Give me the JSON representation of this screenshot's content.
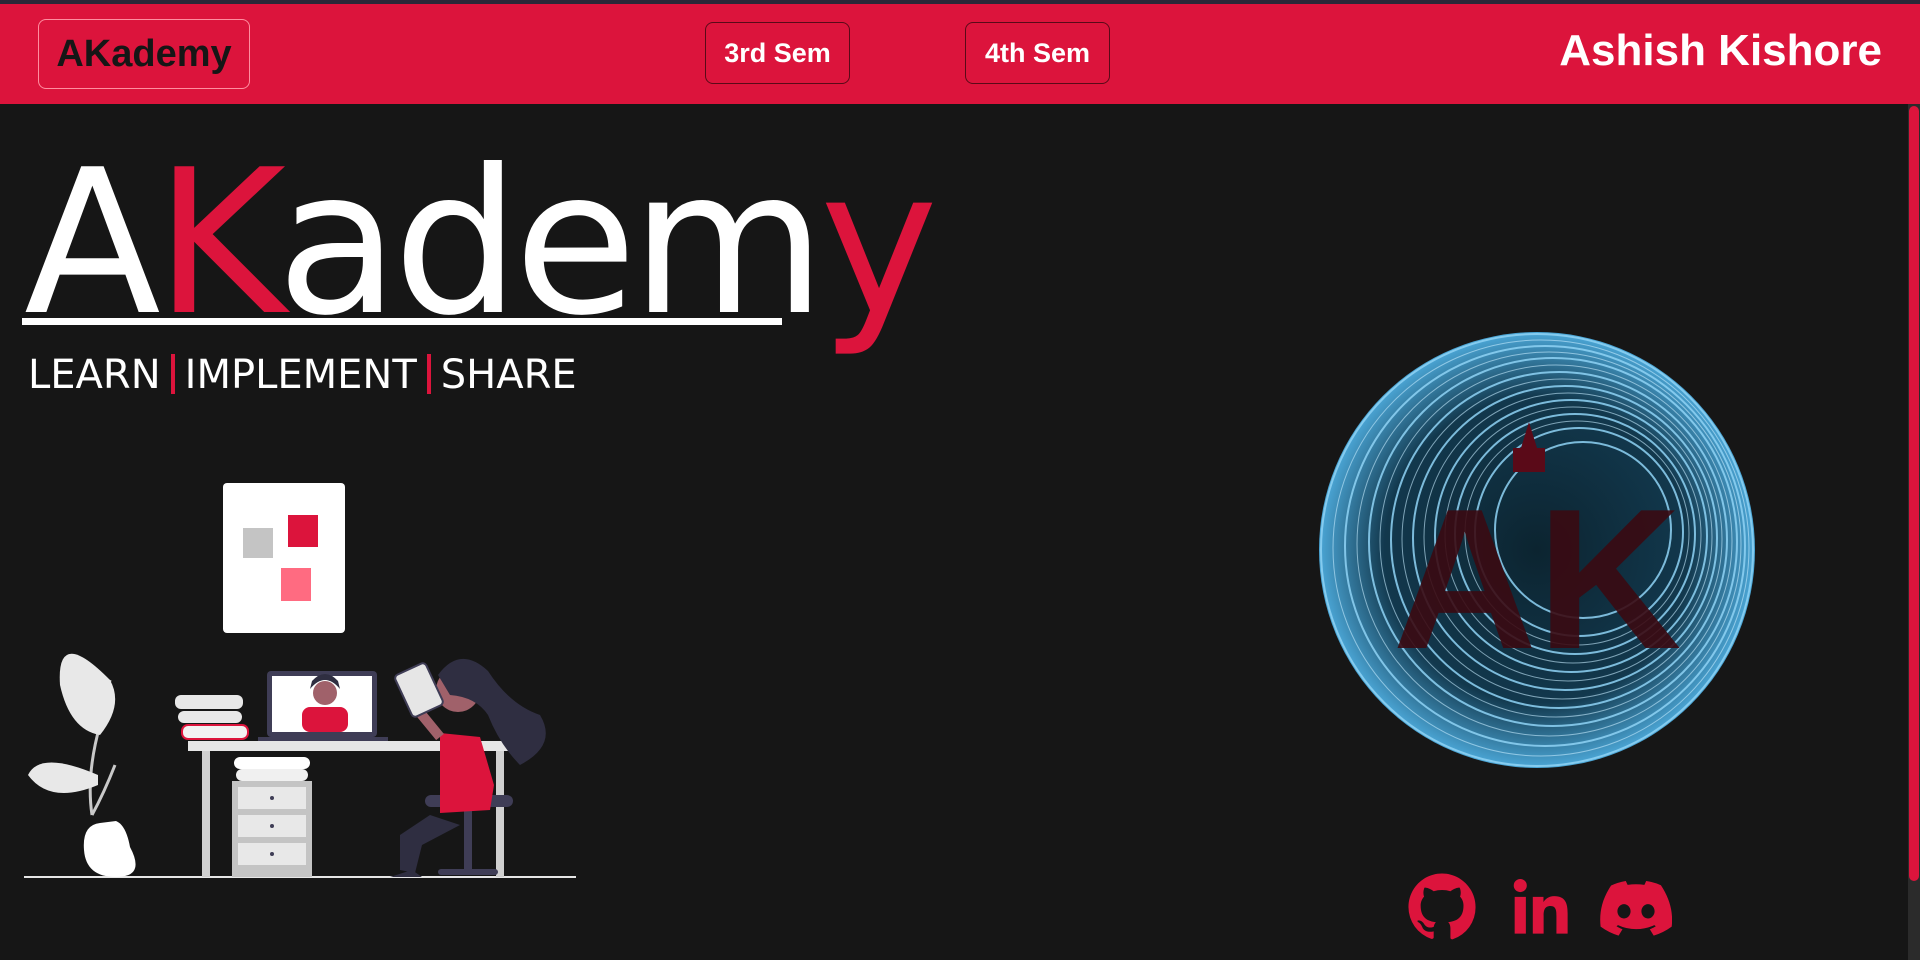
{
  "navbar": {
    "brand_label": "AKademy",
    "nav_buttons": [
      {
        "label": "3rd Sem"
      },
      {
        "label": "4th Sem"
      }
    ],
    "author_name": "Ashish Kishore"
  },
  "hero": {
    "logo_word": {
      "part1": "A",
      "part2": "K",
      "part3": "adem",
      "part4": "y"
    },
    "tagline": [
      "LEARN",
      "IMPLEMENT",
      "SHARE"
    ],
    "illustration_icon": "person-studying-at-desk-illustration",
    "globe_icon": "ak-emblem-globe",
    "globe_emblem_text": "AK"
  },
  "social_links": [
    {
      "icon": "github-icon"
    },
    {
      "icon": "linkedin-icon"
    },
    {
      "icon": "discord-icon"
    }
  ],
  "colors": {
    "accent": "#dc143c",
    "background": "#161616",
    "text": "#ffffff",
    "globe_lines": "#8fd3f5"
  }
}
